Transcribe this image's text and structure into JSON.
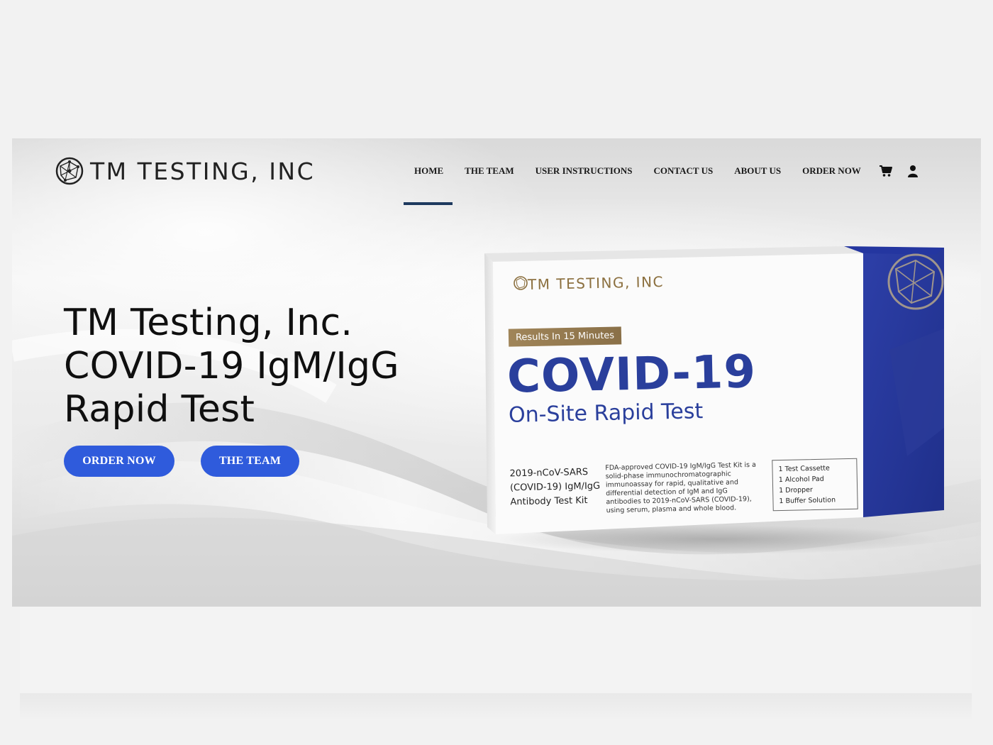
{
  "brand": {
    "name": "TM TESTING, INC"
  },
  "nav": {
    "items": [
      {
        "label": "HOME",
        "active": true
      },
      {
        "label": "THE TEAM"
      },
      {
        "label": "USER INSTRUCTIONS"
      },
      {
        "label": "CONTACT US"
      },
      {
        "label": "ABOUT US"
      },
      {
        "label": "ORDER NOW"
      }
    ],
    "icons": [
      "cart-icon",
      "user-icon"
    ]
  },
  "hero": {
    "headline_lines": [
      "TM Testing, Inc.",
      "COVID-19 IgM/IgG",
      "Rapid Test"
    ],
    "buttons": [
      {
        "label": "ORDER NOW"
      },
      {
        "label": "THE TEAM"
      }
    ]
  },
  "product_box": {
    "brand": "TM TESTING, INC",
    "badge": "Results In 15 Minutes",
    "title": "COVID-19",
    "subtitle": "On-Site Rapid Test",
    "kit_name": "2019-nCoV-SARS (COVID-19) IgM/IgG Antibody Test Kit",
    "description": "FDA-approved COVID-19 IgM/IgG Test Kit is a solid-phase immunochromatographic immunoassay for rapid, qualitative and differential detection of IgM and IgG antibodies to 2019-nCoV-SARS (COVID-19), using serum, plasma and whole blood.",
    "contents": [
      "1  Test Cassette",
      "1  Alcohol Pad",
      "1  Dropper",
      "1  Buffer Solution"
    ]
  },
  "colors": {
    "accent_blue": "#2f5bdc",
    "nav_active": "#1e3a5f",
    "box_blue": "#2a3f9c",
    "gold": "#8b6f3e"
  }
}
